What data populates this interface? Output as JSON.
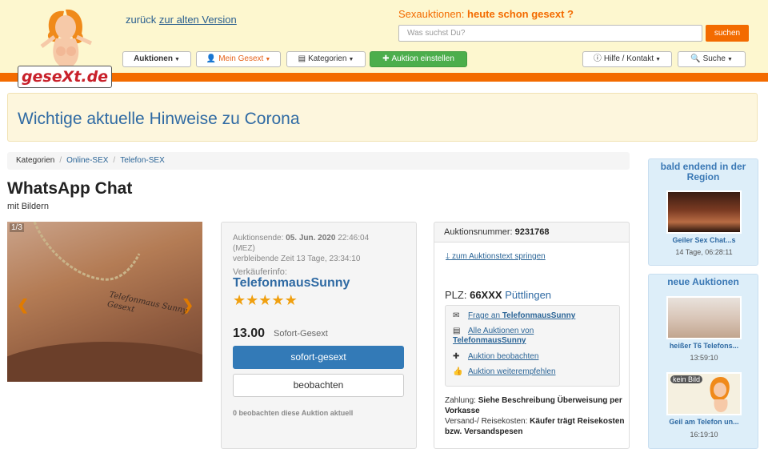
{
  "header": {
    "logo_text": "geseXt.de",
    "back_prefix": "zurück",
    "back_link": "zur alten Version",
    "tagline_prefix": "Sexauktionen:",
    "tagline_highlight": "heute schon gesext ?",
    "search_placeholder": "Was suchst Du?",
    "search_button": "suchen",
    "nav": {
      "auktionen": "Auktionen",
      "mein_gesext": "Mein Gesext",
      "kategorien": "Kategorien",
      "auktion_einstellen": "Auktion einstellen",
      "hilfe": "Hilfe / Kontakt",
      "suche": "Suche"
    }
  },
  "corona_notice": "Wichtige aktuelle Hinweise zu Corona",
  "breadcrumb": [
    "Kategorien",
    "Online-SEX",
    "Telefon-SEX"
  ],
  "listing": {
    "title": "WhatsApp Chat",
    "subtitle": "mit Bildern",
    "image_counter": "1/3",
    "image_text": "Telefonmaus Sunny Gesext",
    "end_label": "Auktionsende:",
    "end_date": "05. Jun. 2020",
    "end_time": "22:46:04",
    "timezone": "(MEZ)",
    "remaining_label": "verbleibende Zeit",
    "remaining": "13 Tage, 23:34:10",
    "seller_label": "Verkäuferinfo:",
    "seller": "TelefonmausSunny",
    "rating_stars": 5,
    "price": "13.00",
    "price_type": "Sofort-Gesext",
    "buy_button": "sofort-gesext",
    "watch_button": "beobachten",
    "watch_count_text": "0 beobachten diese Auktion aktuell"
  },
  "info": {
    "auction_number_label": "Auktionsnummer:",
    "auction_number": "9231768",
    "jump_link": "zum Auktionstext springen",
    "plz_label": "PLZ:",
    "plz": "66XXX",
    "location": "Püttlingen",
    "actions": [
      {
        "icon": "envelope-icon",
        "label": "Frage an",
        "bold": "TelefonmausSunny"
      },
      {
        "icon": "list-icon",
        "label": "Alle Auktionen von",
        "bold": "TelefonmausSunny"
      },
      {
        "icon": "plus-icon",
        "label": "Auktion beobachten",
        "bold": ""
      },
      {
        "icon": "thumbs-up-icon",
        "label": "Auktion weiterempfehlen",
        "bold": ""
      }
    ],
    "payment_label": "Zahlung:",
    "payment": "Siehe Beschreibung Überweisung per Vorkasse",
    "shipping_label": "Versand-/ Reisekosten:",
    "shipping": "Käufer trägt Reisekosten bzw. Versandspesen"
  },
  "sidebar": {
    "ending_title": "bald endend in der Region",
    "ending_items": [
      {
        "caption": "Geiler Sex Chat...s",
        "time": "14 Tage, 06:28:11"
      }
    ],
    "new_title": "neue Auktionen",
    "new_items": [
      {
        "caption": "heißer T6 Telefons...",
        "time": "13:59:10"
      },
      {
        "caption": "Geil am Telefon un...",
        "time": "16:19:10",
        "placeholder_text": "kein Bild"
      }
    ]
  },
  "colors": {
    "header_bg": "#fdf7cf",
    "orange": "#f36b00",
    "link_blue": "#2a6496",
    "primary_blue": "#337ab7",
    "green": "#4cae4c",
    "star": "#f0a010"
  }
}
